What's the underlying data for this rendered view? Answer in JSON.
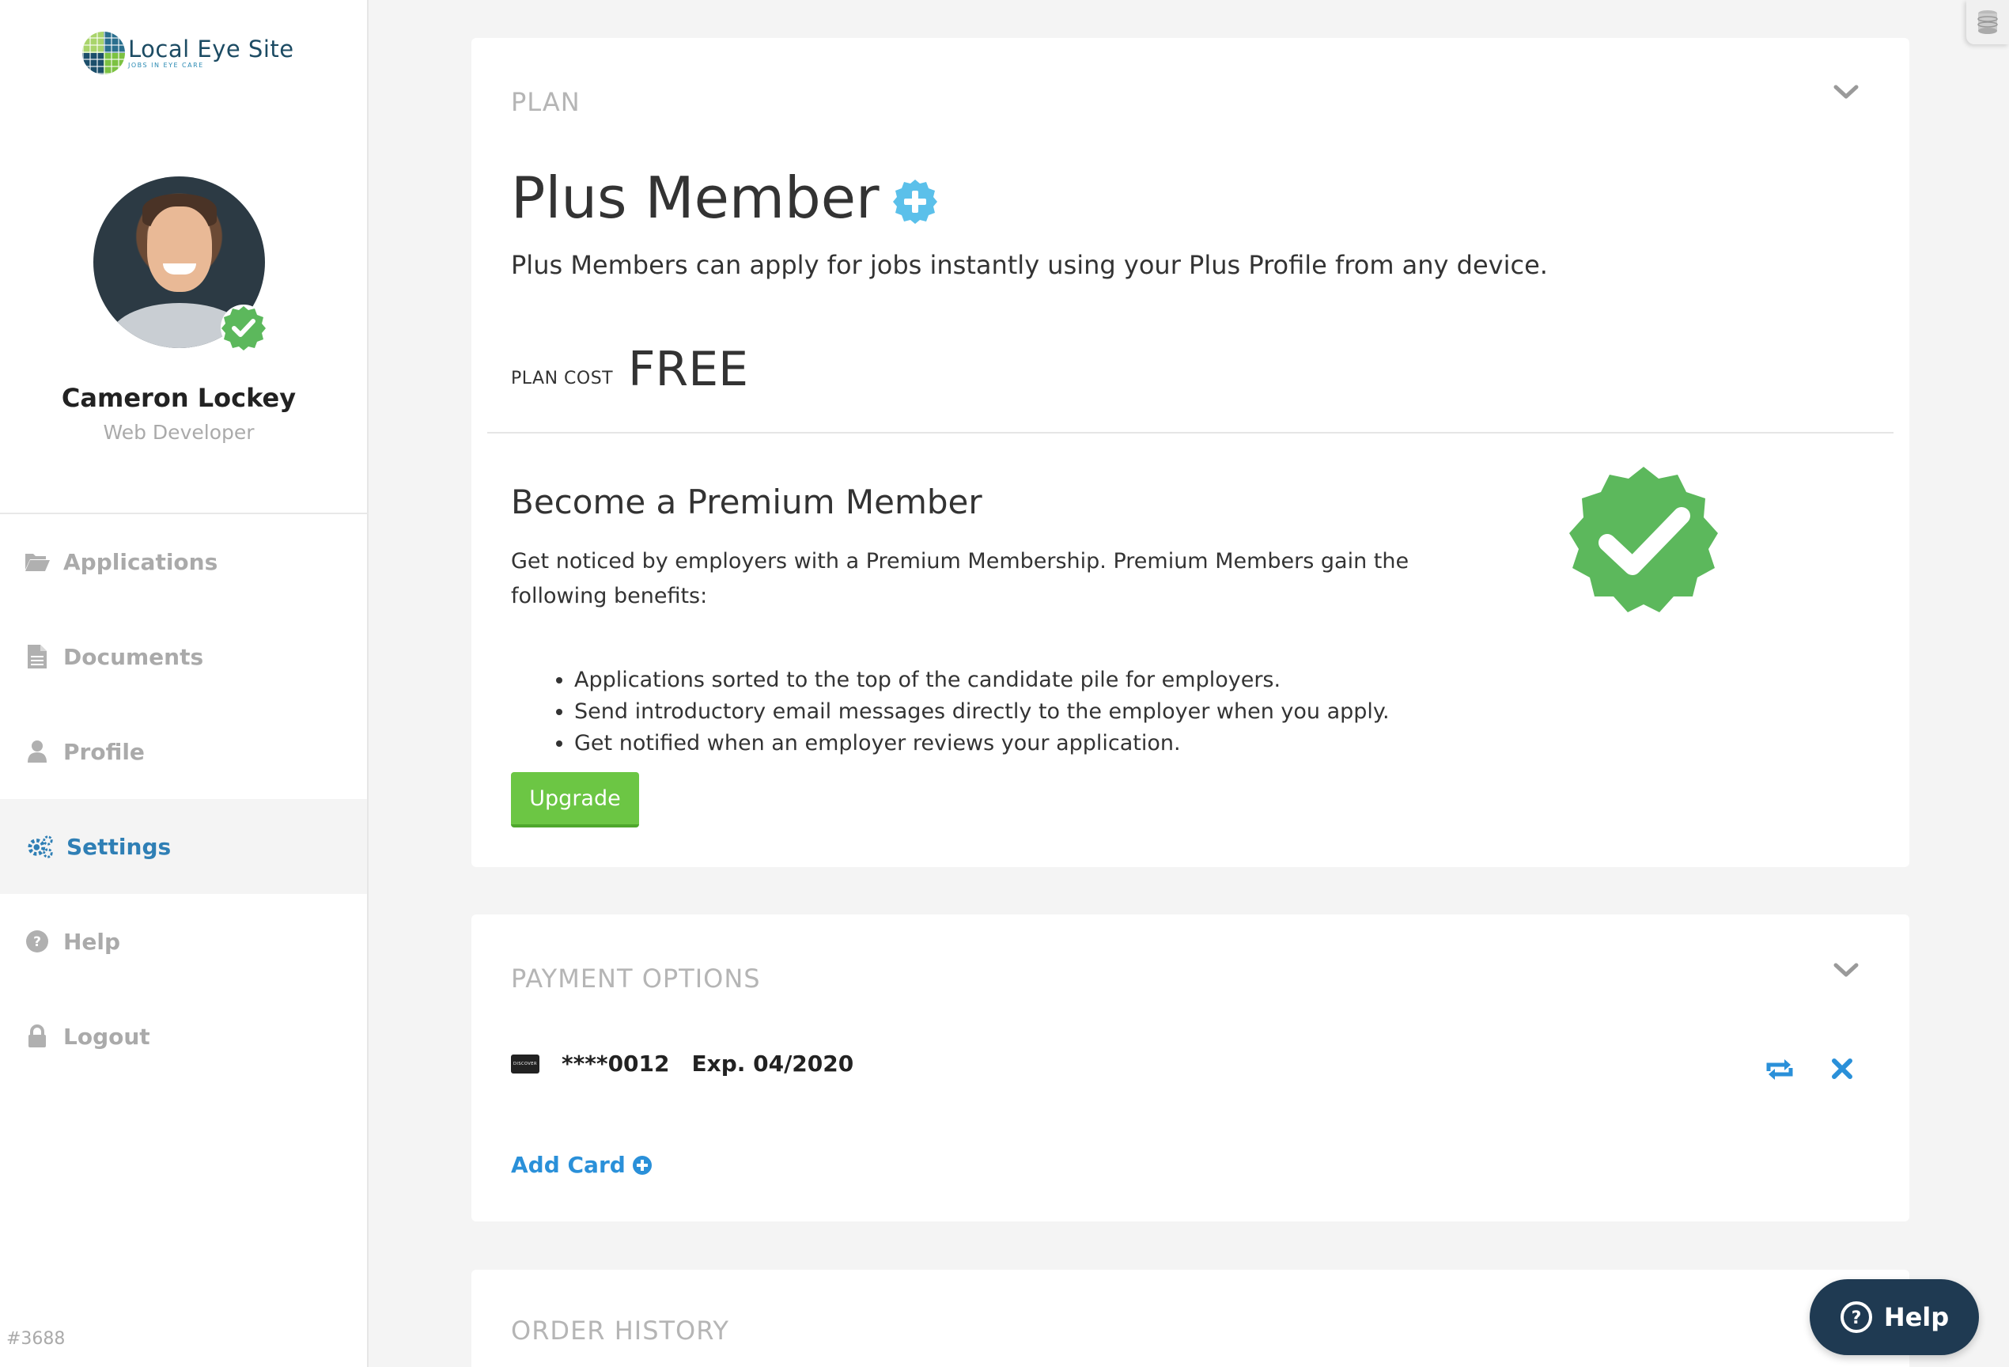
{
  "brand": {
    "name": "Local Eye Site",
    "tagline": "JOBS IN EYE CARE"
  },
  "user": {
    "name": "Cameron Lockey",
    "role": "Web Developer"
  },
  "nav": {
    "items": [
      {
        "label": "Applications",
        "icon": "folder-open-icon"
      },
      {
        "label": "Documents",
        "icon": "document-icon"
      },
      {
        "label": "Profile",
        "icon": "user-icon"
      },
      {
        "label": "Settings",
        "icon": "gears-icon",
        "active": true
      },
      {
        "label": "Help",
        "icon": "question-circle-icon"
      },
      {
        "label": "Logout",
        "icon": "lock-icon"
      }
    ]
  },
  "build_id": "#3688",
  "plan": {
    "heading": "PLAN",
    "title": "Plus Member",
    "description": "Plus Members can apply for jobs instantly using your Plus Profile from any device.",
    "cost_label": "PLAN COST",
    "cost_value": "FREE"
  },
  "premium": {
    "title": "Become a Premium Member",
    "description": "Get noticed by employers with a Premium Membership. Premium Members gain the following benefits:",
    "benefits": [
      "Applications sorted to the top of the candidate pile for employers.",
      "Send introductory email messages directly to the employer when you apply.",
      "Get notified when an employer reviews your application."
    ],
    "upgrade_label": "Upgrade"
  },
  "payment": {
    "heading": "PAYMENT OPTIONS",
    "card_brand": "DISCOVER",
    "card_number": "****0012",
    "card_expiry": "Exp. 04/2020",
    "add_card_label": "Add Card"
  },
  "order_history": {
    "heading": "ORDER HISTORY"
  },
  "help_button": {
    "label": "Help"
  },
  "colors": {
    "accent": "#2f7fb5",
    "link": "#2a90d9",
    "success": "#6cc644",
    "badge_green": "#5cb85c",
    "plus_blue": "#5bc0ea",
    "help_bg": "#1f3a52"
  }
}
